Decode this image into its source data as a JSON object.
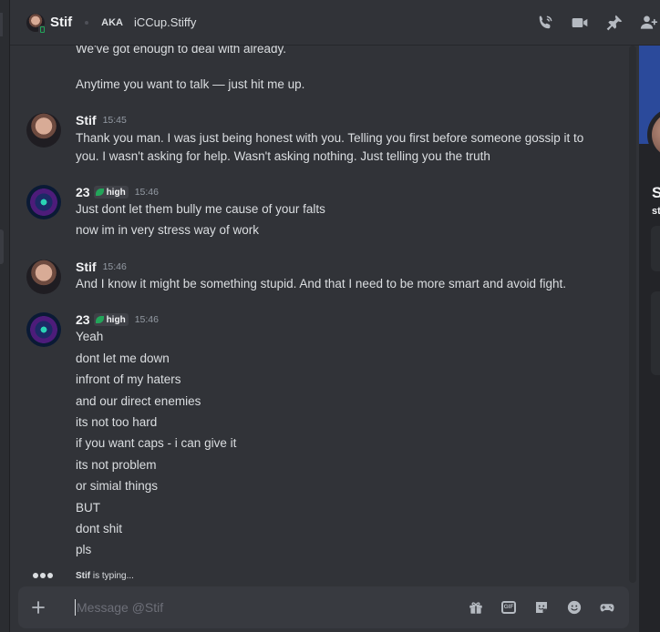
{
  "header": {
    "name": "Stif",
    "aka_label": "AKA",
    "alias": "iCCup.Stiffy",
    "icons": [
      "phone-call-icon",
      "video-call-icon",
      "pin-icon",
      "add-friend-icon"
    ]
  },
  "messages": {
    "continuation": [
      "We've got enough to deal with already.",
      "Anytime you want to talk — just hit me up."
    ],
    "groups": [
      {
        "author": "Stif",
        "time": "15:45",
        "lines": [
          "Thank you man. I was just being honest with you. Telling you first before someone gossip it to",
          "you. I wasn't asking for help. Wasn't asking nothing. Just telling you the truth"
        ]
      },
      {
        "author": "23",
        "tag": "high",
        "time": "15:46",
        "lines": [
          "Just dont let them bully me cause of your falts",
          "now im in very stress way of work"
        ]
      },
      {
        "author": "Stif",
        "time": "15:46",
        "lines": [
          "And I know it might be something stupid. And that I need to be more smart and avoid fight."
        ]
      },
      {
        "author": "23",
        "tag": "high",
        "time": "15:46",
        "lines": [
          "Yeah",
          "dont let me down",
          "infront of my haters",
          "and our direct enemies",
          "its not too hard",
          "if you want caps - i can give it",
          "its not problem",
          "or simial things",
          "BUT",
          "dont shit",
          "pls"
        ]
      }
    ]
  },
  "typing": {
    "name": "Stif",
    "suffix": " is typing..."
  },
  "composer": {
    "placeholder": "Message @Stif",
    "icons": [
      "gift-icon",
      "gif-icon",
      "sticker-icon",
      "emoji-icon",
      "game-controller-icon"
    ],
    "gif_label": "GIF"
  },
  "colors": {
    "background": "#313338",
    "accent_online": "#23a55a",
    "banner": "#2b4a9b"
  }
}
